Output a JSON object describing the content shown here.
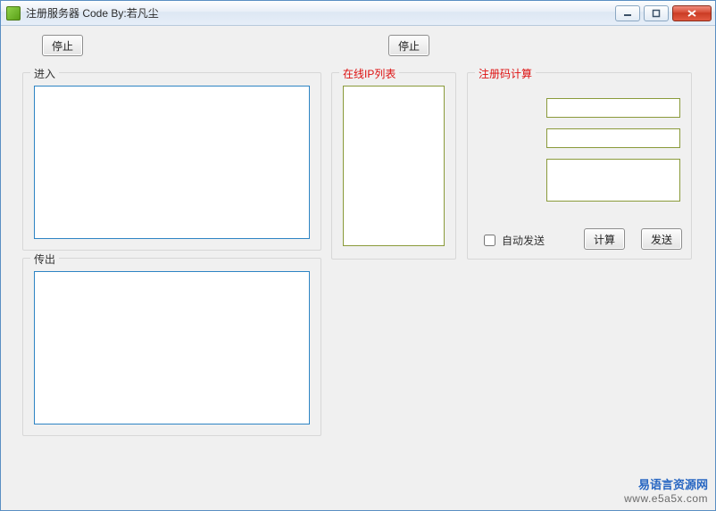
{
  "window": {
    "title": "注册服务器   Code By:若凡尘"
  },
  "buttons": {
    "stop_left": "停止",
    "stop_right": "停止",
    "calc": "计算",
    "send": "发送"
  },
  "groups": {
    "enter": "进入",
    "exit": "传出",
    "online_ip_list": "在线IP列表",
    "regcode_calc": "注册码计算"
  },
  "checkbox": {
    "auto_send_label": "自动发送",
    "auto_send_checked": false
  },
  "inputs": {
    "field1": "",
    "field2": "",
    "field3": ""
  },
  "panels": {
    "enter_log": "",
    "exit_log": "",
    "ip_list": ""
  },
  "watermark": {
    "line1": "易语言资源网",
    "line2": "www.e5a5x.com"
  },
  "win_controls": {
    "minimize_icon": "min",
    "maximize_icon": "max",
    "close_icon": "close"
  }
}
